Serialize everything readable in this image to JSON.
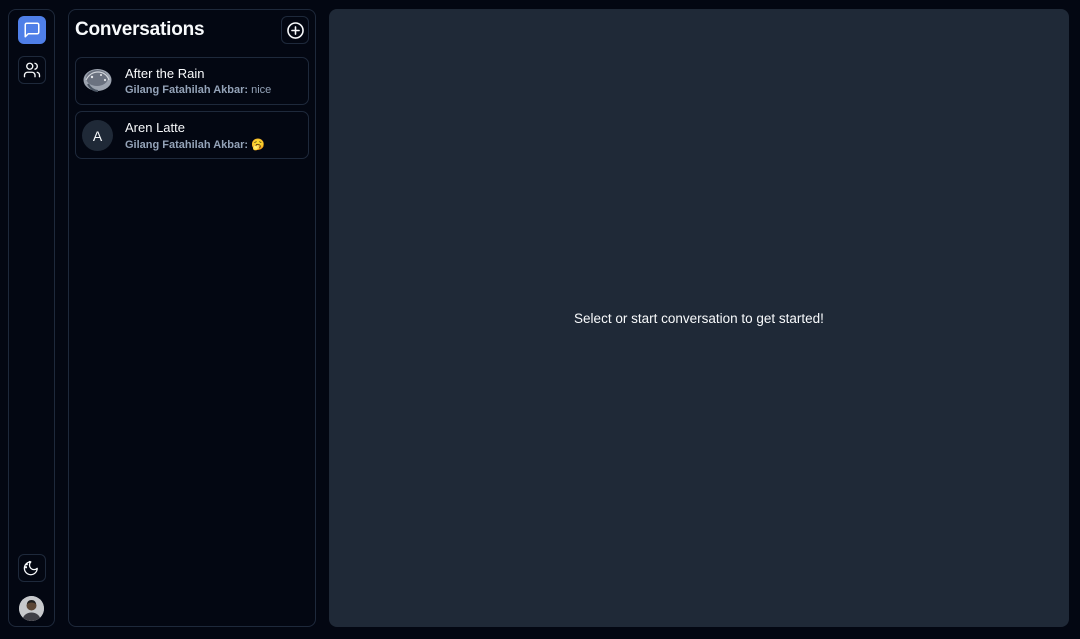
{
  "rail": {
    "items": [
      {
        "icon": "message-square-icon",
        "active": true
      },
      {
        "icon": "users-icon",
        "active": false
      }
    ],
    "bottom": [
      {
        "icon": "theme-toggle-icon"
      }
    ],
    "profile_icon": "user-avatar"
  },
  "conversations": {
    "title": "Conversations",
    "add_icon": "plus-circle-icon",
    "items": [
      {
        "name": "After the Rain",
        "sender": "Gilang Fatahilah Akbar:",
        "preview": "nice",
        "avatar_type": "image"
      },
      {
        "name": "Aren Latte",
        "sender": "Gilang Fatahilah Akbar:",
        "preview": "🥱",
        "avatar_type": "letter",
        "avatar_letter": "A"
      }
    ]
  },
  "main": {
    "empty_message": "Select or start conversation to get started!"
  },
  "colors": {
    "background": "#030712",
    "panel_border": "#1e293b",
    "main_background": "#1f2937",
    "accent": "#4f7fe8",
    "muted_text": "#94a3b8"
  }
}
